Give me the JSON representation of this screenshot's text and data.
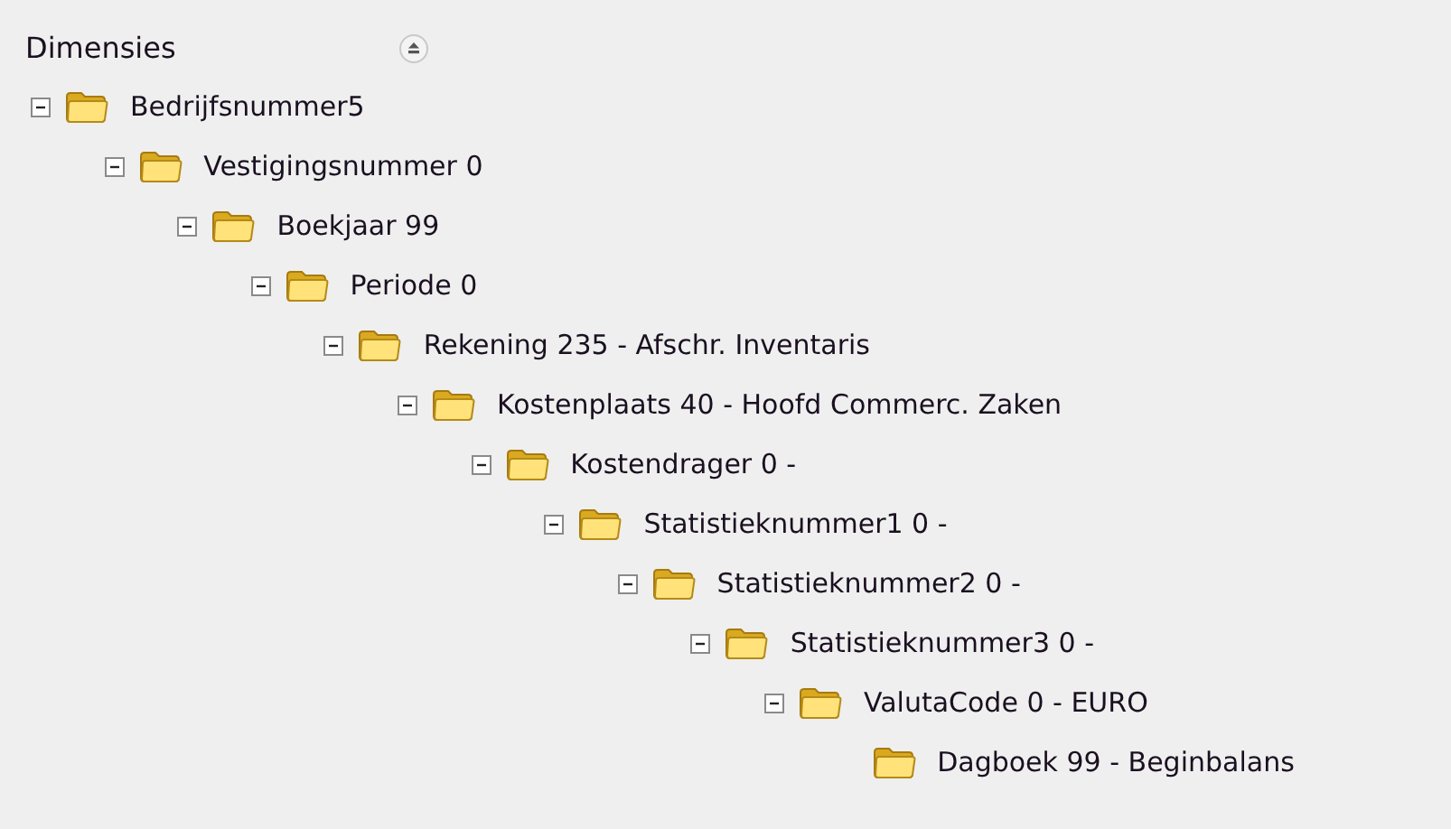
{
  "panel": {
    "title": "Dimensies"
  },
  "tree": [
    {
      "label": "Bedrijfsnummer5",
      "expanded": true,
      "children": [
        {
          "label": "Vestigingsnummer 0",
          "expanded": true,
          "children": [
            {
              "label": "Boekjaar 99",
              "expanded": true,
              "children": [
                {
                  "label": "Periode 0",
                  "expanded": true,
                  "children": [
                    {
                      "label": "Rekening 235 - Afschr. Inventaris",
                      "expanded": true,
                      "children": [
                        {
                          "label": "Kostenplaats 40 - Hoofd Commerc. Zaken",
                          "expanded": true,
                          "children": [
                            {
                              "label": "Kostendrager 0 -",
                              "expanded": true,
                              "children": [
                                {
                                  "label": "Statistieknummer1 0 -",
                                  "expanded": true,
                                  "children": [
                                    {
                                      "label": "Statistieknummer2 0 -",
                                      "expanded": true,
                                      "children": [
                                        {
                                          "label": "Statistieknummer3 0 -",
                                          "expanded": true,
                                          "children": [
                                            {
                                              "label": "ValutaCode 0 - EURO",
                                              "expanded": true,
                                              "children": [
                                                {
                                                  "label": "Dagboek 99 - Beginbalans"
                                                }
                                              ]
                                            }
                                          ]
                                        }
                                      ]
                                    }
                                  ]
                                }
                              ]
                            }
                          ]
                        }
                      ]
                    }
                  ]
                }
              ]
            }
          ]
        }
      ]
    }
  ]
}
